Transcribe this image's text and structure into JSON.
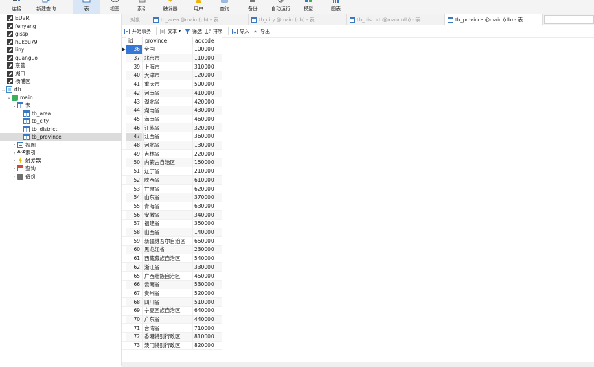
{
  "toolbar": {
    "buttons": [
      {
        "key": "connect",
        "label": "连接"
      },
      {
        "key": "new_query",
        "label": "新建查询"
      },
      {
        "key": "table",
        "label": "表"
      },
      {
        "key": "view",
        "label": "视图"
      },
      {
        "key": "index",
        "label": "索引"
      },
      {
        "key": "trigger",
        "label": "触发器"
      },
      {
        "key": "user",
        "label": "用户"
      },
      {
        "key": "query",
        "label": "查询"
      },
      {
        "key": "backup",
        "label": "备份"
      },
      {
        "key": "automation",
        "label": "自动运行"
      },
      {
        "key": "model",
        "label": "模型"
      },
      {
        "key": "chart",
        "label": "图表"
      }
    ],
    "active": "表"
  },
  "sidebar": {
    "connections": [
      "EDVR",
      "fenyang",
      "gissp",
      "hukou79",
      "linyi",
      "quanguo",
      "东营",
      "湖口",
      "杨浦区"
    ],
    "db_name": "db",
    "schema_name": "main",
    "tables_label": "表",
    "tables": [
      "tb_area",
      "tb_city",
      "tb_district",
      "tb_province"
    ],
    "selected_table": "tb_province",
    "groups": [
      "视图",
      "索引",
      "触发器",
      "查询",
      "备份"
    ],
    "index_icon_text": "A-Z"
  },
  "tabs": {
    "objects_label": "对象",
    "items": [
      "tb_area @main (db) - 表",
      "tb_city @main (db) - 表",
      "tb_district @main (db) - 表",
      "tb_province @main (db) - 表"
    ]
  },
  "subtoolbar": {
    "begin_transaction": "开始事务",
    "text": "文本",
    "filter": "筛选",
    "sort": "排序",
    "import": "导入",
    "export": "导出"
  },
  "table": {
    "columns": [
      "id",
      "province",
      "adcode"
    ],
    "rows": [
      [
        "36",
        "全国",
        "100000"
      ],
      [
        "37",
        "北京市",
        "110000"
      ],
      [
        "39",
        "上海市",
        "310000"
      ],
      [
        "40",
        "天津市",
        "120000"
      ],
      [
        "41",
        "重庆市",
        "500000"
      ],
      [
        "42",
        "河南省",
        "410000"
      ],
      [
        "43",
        "湖北省",
        "420000"
      ],
      [
        "44",
        "湖南省",
        "430000"
      ],
      [
        "45",
        "海南省",
        "460000"
      ],
      [
        "46",
        "江苏省",
        "320000"
      ],
      [
        "47",
        "江西省",
        "360000"
      ],
      [
        "48",
        "河北省",
        "130000"
      ],
      [
        "49",
        "吉林省",
        "220000"
      ],
      [
        "50",
        "内蒙古自治区",
        "150000"
      ],
      [
        "51",
        "辽宁省",
        "210000"
      ],
      [
        "52",
        "陕西省",
        "610000"
      ],
      [
        "53",
        "甘肃省",
        "620000"
      ],
      [
        "54",
        "山东省",
        "370000"
      ],
      [
        "55",
        "青海省",
        "630000"
      ],
      [
        "56",
        "安徽省",
        "340000"
      ],
      [
        "57",
        "福建省",
        "350000"
      ],
      [
        "58",
        "山西省",
        "140000"
      ],
      [
        "59",
        "新疆维吾尔自治区",
        "650000"
      ],
      [
        "60",
        "黑龙江省",
        "230000"
      ],
      [
        "61",
        "西藏藏族自治区",
        "540000"
      ],
      [
        "62",
        "浙江省",
        "330000"
      ],
      [
        "65",
        "广西壮族自治区",
        "450000"
      ],
      [
        "66",
        "云南省",
        "530000"
      ],
      [
        "67",
        "贵州省",
        "520000"
      ],
      [
        "68",
        "四川省",
        "510000"
      ],
      [
        "69",
        "宁夏回族自治区",
        "640000"
      ],
      [
        "70",
        "广东省",
        "440000"
      ],
      [
        "71",
        "台湾省",
        "710000"
      ],
      [
        "72",
        "香港特别行政区",
        "810000"
      ],
      [
        "73",
        "澳门特别行政区",
        "820000"
      ]
    ],
    "current_row_marker": "▶"
  },
  "colors": {
    "accent": "#3477d9",
    "toolbar_bg": "#f4f4f4",
    "active_toolbar_bg": "#d8e6f5",
    "selection_bg": "#dcdcdc"
  }
}
